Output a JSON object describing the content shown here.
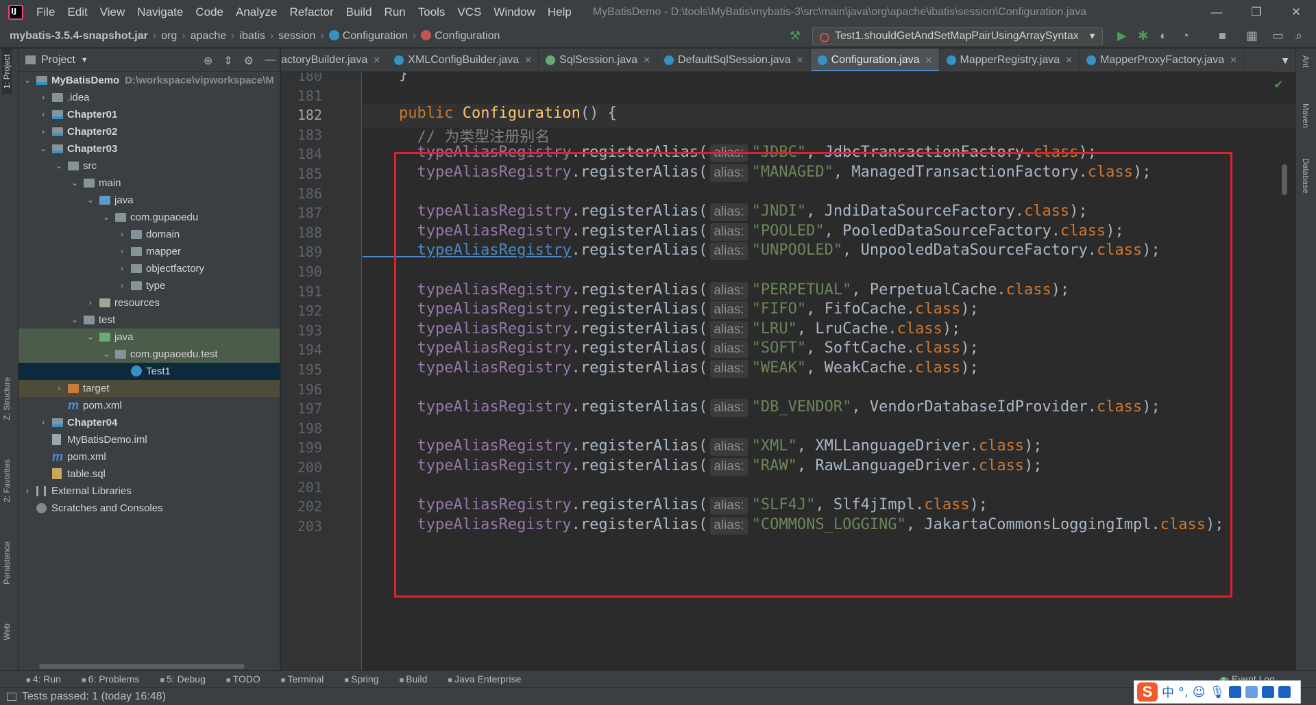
{
  "menubar": {
    "items": [
      "File",
      "Edit",
      "View",
      "Navigate",
      "Code",
      "Analyze",
      "Refactor",
      "Build",
      "Run",
      "Tools",
      "VCS",
      "Window",
      "Help"
    ],
    "title": "MyBatisDemo - D:\\tools\\MyBatis\\mybatis-3\\src\\main\\java\\org\\apache\\ibatis\\session\\Configuration.java",
    "window_buttons": [
      "—",
      "❐",
      "✕"
    ]
  },
  "navbar": {
    "crumbs": [
      "mybatis-3.5.4-snapshot.jar",
      "org",
      "apache",
      "ibatis",
      "session",
      "Configuration",
      "Configuration"
    ],
    "run_config": "Test1.shouldGetAndSetMapPairUsingArraySyntax"
  },
  "left_stripe": [
    "1: Project",
    "Z: Structure",
    "2: Favorites",
    "Persistence",
    "Web"
  ],
  "right_stripe": [
    "Ant",
    "Maven",
    "Database"
  ],
  "project": {
    "title": "Project",
    "tree": [
      {
        "label": "MyBatisDemo",
        "path": "D:\\workspace\\vipworkspace\\M",
        "depth": 0,
        "twisty": "open",
        "icon": "folder-mod",
        "bold": true
      },
      {
        "label": ".idea",
        "depth": 1,
        "twisty": "closed",
        "icon": "folder"
      },
      {
        "label": "Chapter01",
        "depth": 1,
        "twisty": "closed",
        "icon": "folder-mod",
        "bold": true
      },
      {
        "label": "Chapter02",
        "depth": 1,
        "twisty": "closed",
        "icon": "folder-mod",
        "bold": true
      },
      {
        "label": "Chapter03",
        "depth": 1,
        "twisty": "open",
        "icon": "folder-mod",
        "bold": true
      },
      {
        "label": "src",
        "depth": 2,
        "twisty": "open",
        "icon": "folder"
      },
      {
        "label": "main",
        "depth": 3,
        "twisty": "open",
        "icon": "folder"
      },
      {
        "label": "java",
        "depth": 4,
        "twisty": "open",
        "icon": "src"
      },
      {
        "label": "com.gupaoedu",
        "depth": 5,
        "twisty": "open",
        "icon": "pkg"
      },
      {
        "label": "domain",
        "depth": 6,
        "twisty": "closed",
        "icon": "pkg"
      },
      {
        "label": "mapper",
        "depth": 6,
        "twisty": "closed",
        "icon": "pkg"
      },
      {
        "label": "objectfactory",
        "depth": 6,
        "twisty": "closed",
        "icon": "pkg"
      },
      {
        "label": "type",
        "depth": 6,
        "twisty": "closed",
        "icon": "pkg"
      },
      {
        "label": "resources",
        "depth": 4,
        "twisty": "closed",
        "icon": "res"
      },
      {
        "label": "test",
        "depth": 3,
        "twisty": "open",
        "icon": "folder"
      },
      {
        "label": "java",
        "depth": 4,
        "twisty": "open",
        "icon": "test",
        "highlight": "green"
      },
      {
        "label": "com.gupaoedu.test",
        "depth": 5,
        "twisty": "open",
        "icon": "pkg",
        "highlight": "green"
      },
      {
        "label": "Test1",
        "depth": 6,
        "twisty": "",
        "icon": "cls",
        "highlight": "blue"
      },
      {
        "label": "target",
        "depth": 2,
        "twisty": "closed",
        "icon": "target",
        "highlight": "orange"
      },
      {
        "label": "pom.xml",
        "depth": 2,
        "twisty": "",
        "icon": "xml"
      },
      {
        "label": "Chapter04",
        "depth": 1,
        "twisty": "closed",
        "icon": "folder-mod",
        "bold": true
      },
      {
        "label": "MyBatisDemo.iml",
        "depth": 1,
        "twisty": "",
        "icon": "iml"
      },
      {
        "label": "pom.xml",
        "depth": 1,
        "twisty": "",
        "icon": "xml"
      },
      {
        "label": "table.sql",
        "depth": 1,
        "twisty": "",
        "icon": "sql"
      },
      {
        "label": "External Libraries",
        "depth": 0,
        "twisty": "closed",
        "icon": "lib"
      },
      {
        "label": "Scratches and Consoles",
        "depth": 0,
        "twisty": "",
        "icon": "scr"
      }
    ]
  },
  "tabs": [
    {
      "label": "actoryBuilder.java",
      "icon": "none"
    },
    {
      "label": "XMLConfigBuilder.java",
      "icon": "class"
    },
    {
      "label": "SqlSession.java",
      "icon": "interface"
    },
    {
      "label": "DefaultSqlSession.java",
      "icon": "class"
    },
    {
      "label": "Configuration.java",
      "icon": "class",
      "active": true
    },
    {
      "label": "MapperRegistry.java",
      "icon": "class"
    },
    {
      "label": "MapperProxyFactory.java",
      "icon": "class"
    }
  ],
  "editor": {
    "hint_label": "alias:",
    "current_line": 182,
    "lines": [
      {
        "n": 180,
        "parts": [
          [
            "",
            "    }"
          ]
        ]
      },
      {
        "n": 181,
        "parts": []
      },
      {
        "n": 182,
        "parts": [
          [
            "kw",
            "    public "
          ],
          [
            "fn",
            "Configuration"
          ],
          [
            "",
            "() {"
          ]
        ]
      },
      {
        "n": 183,
        "parts": [
          [
            "cmt",
            "      // 为类型注册别名"
          ]
        ]
      },
      {
        "n": 184,
        "parts": [
          [
            "fld",
            "      typeAliasRegistry"
          ],
          [
            "",
            ".registerAlias("
          ],
          [
            "hint",
            ""
          ],
          [
            "str",
            "\"JDBC\""
          ],
          [
            "",
            ", JdbcTransactionFactory."
          ],
          [
            "kw",
            "class"
          ],
          [
            "",
            ");"
          ]
        ]
      },
      {
        "n": 185,
        "parts": [
          [
            "fld",
            "      typeAliasRegistry"
          ],
          [
            "",
            ".registerAlias("
          ],
          [
            "hint",
            ""
          ],
          [
            "str",
            "\"MANAGED\""
          ],
          [
            "",
            ", ManagedTransactionFactory."
          ],
          [
            "kw",
            "class"
          ],
          [
            "",
            ");"
          ]
        ]
      },
      {
        "n": 186,
        "parts": []
      },
      {
        "n": 187,
        "parts": [
          [
            "fld",
            "      typeAliasRegistry"
          ],
          [
            "",
            ".registerAlias("
          ],
          [
            "hint",
            ""
          ],
          [
            "str",
            "\"JNDI\""
          ],
          [
            "",
            ", JndiDataSourceFactory."
          ],
          [
            "kw",
            "class"
          ],
          [
            "",
            ");"
          ]
        ]
      },
      {
        "n": 188,
        "parts": [
          [
            "fld",
            "      typeAliasRegistry"
          ],
          [
            "",
            ".registerAlias("
          ],
          [
            "hint",
            ""
          ],
          [
            "str",
            "\"POOLED\""
          ],
          [
            "",
            ", PooledDataSourceFactory."
          ],
          [
            "kw",
            "class"
          ],
          [
            "",
            ");"
          ]
        ]
      },
      {
        "n": 189,
        "parts": [
          [
            "fld link",
            "      typeAliasRegistry"
          ],
          [
            "",
            ".registerAlias("
          ],
          [
            "hint",
            ""
          ],
          [
            "str",
            "\"UNPOOLED\""
          ],
          [
            "",
            ", UnpooledDataSourceFactory."
          ],
          [
            "kw",
            "class"
          ],
          [
            "",
            ");"
          ]
        ]
      },
      {
        "n": 190,
        "parts": []
      },
      {
        "n": 191,
        "parts": [
          [
            "fld",
            "      typeAliasRegistry"
          ],
          [
            "",
            ".registerAlias("
          ],
          [
            "hint",
            ""
          ],
          [
            "str",
            "\"PERPETUAL\""
          ],
          [
            "",
            ", PerpetualCache."
          ],
          [
            "kw",
            "class"
          ],
          [
            "",
            ");"
          ]
        ]
      },
      {
        "n": 192,
        "parts": [
          [
            "fld",
            "      typeAliasRegistry"
          ],
          [
            "",
            ".registerAlias("
          ],
          [
            "hint",
            ""
          ],
          [
            "str",
            "\"FIFO\""
          ],
          [
            "",
            ", FifoCache."
          ],
          [
            "kw",
            "class"
          ],
          [
            "",
            ");"
          ]
        ]
      },
      {
        "n": 193,
        "parts": [
          [
            "fld",
            "      typeAliasRegistry"
          ],
          [
            "",
            ".registerAlias("
          ],
          [
            "hint",
            ""
          ],
          [
            "str",
            "\"LRU\""
          ],
          [
            "",
            ", LruCache."
          ],
          [
            "kw",
            "class"
          ],
          [
            "",
            ");"
          ]
        ]
      },
      {
        "n": 194,
        "parts": [
          [
            "fld",
            "      typeAliasRegistry"
          ],
          [
            "",
            ".registerAlias("
          ],
          [
            "hint",
            ""
          ],
          [
            "str",
            "\"SOFT\""
          ],
          [
            "",
            ", SoftCache."
          ],
          [
            "kw",
            "class"
          ],
          [
            "",
            ");"
          ]
        ]
      },
      {
        "n": 195,
        "parts": [
          [
            "fld",
            "      typeAliasRegistry"
          ],
          [
            "",
            ".registerAlias("
          ],
          [
            "hint",
            ""
          ],
          [
            "str",
            "\"WEAK\""
          ],
          [
            "",
            ", WeakCache."
          ],
          [
            "kw",
            "class"
          ],
          [
            "",
            ");"
          ]
        ]
      },
      {
        "n": 196,
        "parts": []
      },
      {
        "n": 197,
        "parts": [
          [
            "fld",
            "      typeAliasRegistry"
          ],
          [
            "",
            ".registerAlias("
          ],
          [
            "hint",
            ""
          ],
          [
            "str",
            "\"DB_VENDOR\""
          ],
          [
            "",
            ", VendorDatabaseIdProvider."
          ],
          [
            "kw",
            "class"
          ],
          [
            "",
            ");"
          ]
        ]
      },
      {
        "n": 198,
        "parts": []
      },
      {
        "n": 199,
        "parts": [
          [
            "fld",
            "      typeAliasRegistry"
          ],
          [
            "",
            ".registerAlias("
          ],
          [
            "hint",
            ""
          ],
          [
            "str",
            "\"XML\""
          ],
          [
            "",
            ", XMLLanguageDriver."
          ],
          [
            "kw",
            "class"
          ],
          [
            "",
            ");"
          ]
        ]
      },
      {
        "n": 200,
        "parts": [
          [
            "fld",
            "      typeAliasRegistry"
          ],
          [
            "",
            ".registerAlias("
          ],
          [
            "hint",
            ""
          ],
          [
            "str",
            "\"RAW\""
          ],
          [
            "",
            ", RawLanguageDriver."
          ],
          [
            "kw",
            "class"
          ],
          [
            "",
            ");"
          ]
        ]
      },
      {
        "n": 201,
        "parts": []
      },
      {
        "n": 202,
        "parts": [
          [
            "fld",
            "      typeAliasRegistry"
          ],
          [
            "",
            ".registerAlias("
          ],
          [
            "hint",
            ""
          ],
          [
            "str",
            "\"SLF4J\""
          ],
          [
            "",
            ", Slf4jImpl."
          ],
          [
            "kw",
            "class"
          ],
          [
            "",
            ");"
          ]
        ]
      },
      {
        "n": 203,
        "parts": [
          [
            "fld",
            "      typeAliasRegistry"
          ],
          [
            "",
            ".registerAlias("
          ],
          [
            "hint",
            ""
          ],
          [
            "str",
            "\"COMMONS_LOGGING\""
          ],
          [
            "",
            ", JakartaCommonsLoggingImpl."
          ],
          [
            "kw",
            "class"
          ],
          [
            "",
            ");"
          ]
        ]
      }
    ]
  },
  "bottombar": {
    "items": [
      "4: Run",
      "6: Problems",
      "5: Debug",
      "TODO",
      "Terminal",
      "Spring",
      "Build",
      "Java Enterprise"
    ],
    "event_log": "Event Log"
  },
  "statusbar": {
    "text": "Tests passed: 1 (today 16:48)"
  },
  "ime": {
    "mode": "中"
  },
  "colors": {
    "highlight_box": "#e0202a",
    "keyword": "#cc7832",
    "field": "#9876aa",
    "string": "#6a8759",
    "method_decl": "#ffc66d",
    "comment": "#808080"
  }
}
